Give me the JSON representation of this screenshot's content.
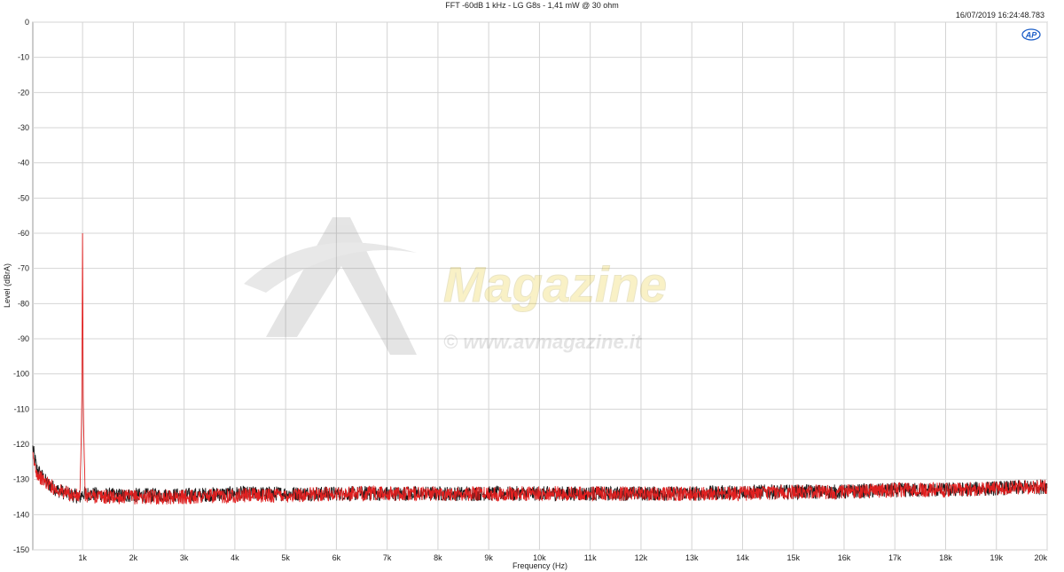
{
  "header": {
    "title": "FFT -60dB 1 kHz - LG G8s - 1,41 mW @ 30 ohm",
    "timestamp": "16/07/2019 16:24:48.783",
    "logo_text": "AP"
  },
  "watermark": {
    "brand": "AV Magazine",
    "url": "© www.avmagazine.it"
  },
  "colors": {
    "series_black": "#1a1a1a",
    "series_red": "#e02020",
    "grid": "#d4d4d4",
    "logo": "#1e5fc8"
  },
  "chart_data": {
    "type": "line",
    "title": "FFT -60dB 1 kHz - LG G8s - 1,41 mW @ 30 ohm",
    "xlabel": "Frequency (Hz)",
    "ylabel": "Level (dBrA)",
    "xlim": [
      20,
      20000
    ],
    "ylim": [
      -150,
      0
    ],
    "grid": true,
    "x_ticks": [
      1000,
      2000,
      3000,
      4000,
      5000,
      6000,
      7000,
      8000,
      9000,
      10000,
      11000,
      12000,
      13000,
      14000,
      15000,
      16000,
      17000,
      18000,
      19000,
      20000
    ],
    "x_tick_labels": [
      "1k",
      "2k",
      "3k",
      "4k",
      "5k",
      "6k",
      "7k",
      "8k",
      "9k",
      "10k",
      "11k",
      "12k",
      "13k",
      "14k",
      "15k",
      "16k",
      "17k",
      "18k",
      "19k",
      "20k"
    ],
    "y_ticks": [
      0,
      -10,
      -20,
      -30,
      -40,
      -50,
      -60,
      -70,
      -80,
      -90,
      -100,
      -110,
      -120,
      -130,
      -140,
      -150
    ],
    "y_tick_labels": [
      "0",
      "-10",
      "-20",
      "-30",
      "-40",
      "-50",
      "-60",
      "-70",
      "-80",
      "-90",
      "-100",
      "-110",
      "-120",
      "-130",
      "-140",
      "-150"
    ],
    "series": [
      {
        "color": "#1a1a1a",
        "x": [
          20,
          100,
          200,
          300,
          400,
          500,
          700,
          950,
          1000,
          1050,
          1500,
          2000,
          3000,
          4000,
          5000,
          6000,
          7000,
          8000,
          9000,
          10000,
          11000,
          12000,
          13000,
          14000,
          15000,
          16000,
          17000,
          18000,
          19000,
          20000
        ],
        "y": [
          -121,
          -127,
          -129,
          -131,
          -132,
          -133,
          -134,
          -135,
          -134,
          -134,
          -134.5,
          -134.5,
          -134.5,
          -134,
          -134,
          -134,
          -134,
          -134,
          -134,
          -134,
          -134,
          -134,
          -134,
          -133.5,
          -133.5,
          -133.5,
          -133,
          -133,
          -132.5,
          -132
        ]
      },
      {
        "color": "#e02020",
        "x": [
          20,
          100,
          200,
          300,
          400,
          500,
          700,
          950,
          985,
          1000,
          1015,
          1050,
          1500,
          2000,
          3000,
          4000,
          5000,
          6000,
          7000,
          8000,
          9000,
          10000,
          11000,
          12000,
          13000,
          14000,
          15000,
          16000,
          17000,
          18000,
          19000,
          20000
        ],
        "y": [
          -124,
          -128,
          -130,
          -131,
          -132,
          -133,
          -134,
          -135,
          -110,
          -60,
          -110,
          -134.5,
          -135,
          -135,
          -135,
          -134.5,
          -134.5,
          -134,
          -134,
          -134,
          -134,
          -134,
          -134,
          -134,
          -134,
          -134,
          -133.5,
          -133.5,
          -133,
          -133,
          -132.5,
          -132
        ]
      }
    ]
  }
}
